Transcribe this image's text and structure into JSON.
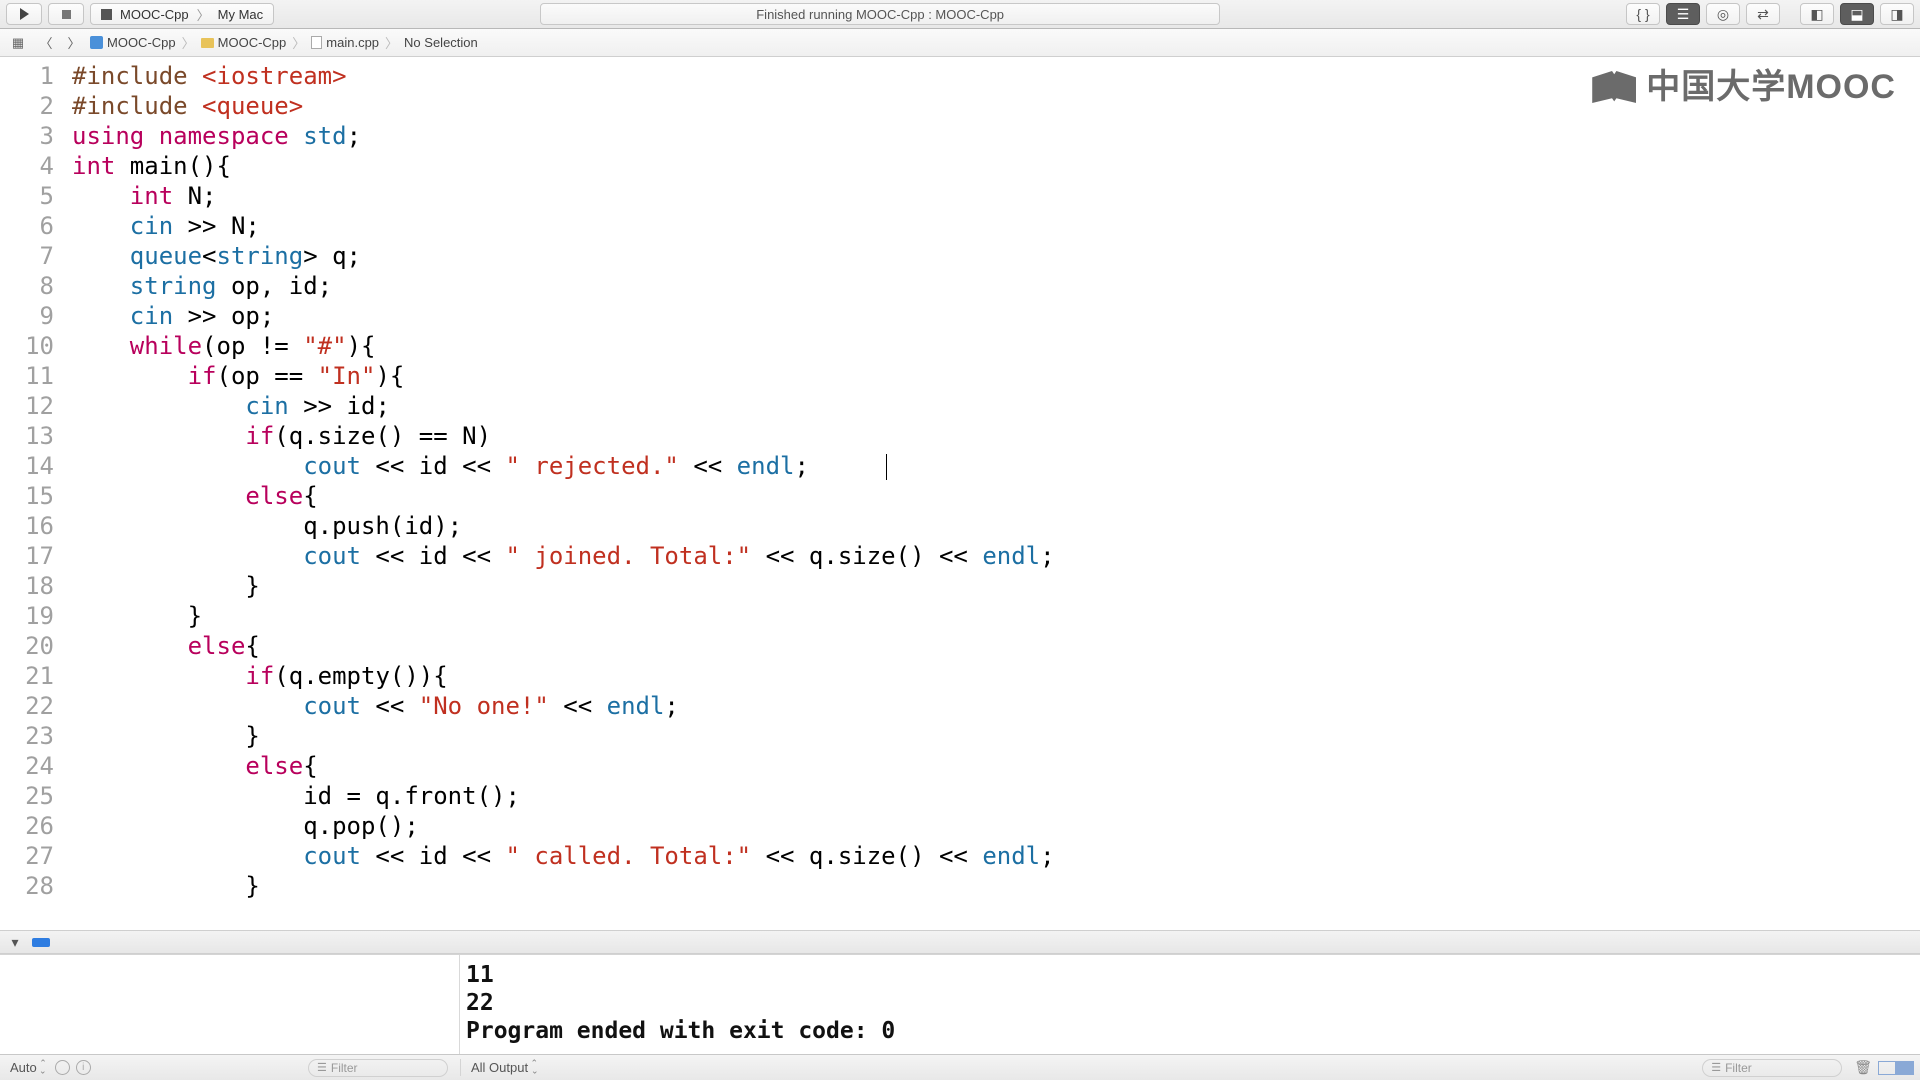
{
  "toolbar": {
    "scheme_project": "MOOC-Cpp",
    "scheme_destination": "My Mac",
    "status": "Finished running MOOC-Cpp : MOOC-Cpp"
  },
  "jumpbar": {
    "project": "MOOC-Cpp",
    "folder": "MOOC-Cpp",
    "file": "main.cpp",
    "selection": "No Selection"
  },
  "watermark": "中国大学MOOC",
  "code": {
    "lines": [
      {
        "n": 1,
        "html": "<span class='pp'>#include</span> <span class='inc'>&lt;iostream&gt;</span>"
      },
      {
        "n": 2,
        "html": "<span class='pp'>#include</span> <span class='inc'>&lt;queue&gt;</span>"
      },
      {
        "n": 3,
        "html": "<span class='kw'>using</span> <span class='kw'>namespace</span> <span class='id'>std</span>;"
      },
      {
        "n": 4,
        "html": "<span class='kw'>int</span> main(){"
      },
      {
        "n": 5,
        "html": "    <span class='kw'>int</span> N;"
      },
      {
        "n": 6,
        "html": "    <span class='id'>cin</span> &gt;&gt; N;"
      },
      {
        "n": 7,
        "html": "    <span class='id'>queue</span>&lt;<span class='id'>string</span>&gt; q;"
      },
      {
        "n": 8,
        "html": "    <span class='id'>string</span> op, id;"
      },
      {
        "n": 9,
        "html": "    <span class='id'>cin</span> &gt;&gt; op;"
      },
      {
        "n": 10,
        "html": "    <span class='kw'>while</span>(op != <span class='str'>\"#\"</span>){"
      },
      {
        "n": 11,
        "html": "        <span class='kw'>if</span>(op == <span class='str'>\"In\"</span>){"
      },
      {
        "n": 12,
        "html": "            <span class='id'>cin</span> &gt;&gt; id;"
      },
      {
        "n": 13,
        "html": "            <span class='kw'>if</span>(q.size() == N)"
      },
      {
        "n": 14,
        "html": "                <span class='id'>cout</span> &lt;&lt; id &lt;&lt; <span class='str'>\" rejected.\"</span> &lt;&lt; <span class='id'>endl</span>;"
      },
      {
        "n": 15,
        "html": "            <span class='kw'>else</span>{"
      },
      {
        "n": 16,
        "html": "                q.push(id);"
      },
      {
        "n": 17,
        "html": "                <span class='id'>cout</span> &lt;&lt; id &lt;&lt; <span class='str'>\" joined. Total:\"</span> &lt;&lt; q.size() &lt;&lt; <span class='id'>endl</span>;"
      },
      {
        "n": 18,
        "html": "            }"
      },
      {
        "n": 19,
        "html": "        }"
      },
      {
        "n": 20,
        "html": "        <span class='kw'>else</span>{"
      },
      {
        "n": 21,
        "html": "            <span class='kw'>if</span>(q.empty()){"
      },
      {
        "n": 22,
        "html": "                <span class='id'>cout</span> &lt;&lt; <span class='str'>\"No one!\"</span> &lt;&lt; <span class='id'>endl</span>;"
      },
      {
        "n": 23,
        "html": "            }"
      },
      {
        "n": 24,
        "html": "            <span class='kw'>else</span>{"
      },
      {
        "n": 25,
        "html": "                id = q.front();"
      },
      {
        "n": 26,
        "html": "                q.pop();"
      },
      {
        "n": 27,
        "html": "                <span class='id'>cout</span> &lt;&lt; id &lt;&lt; <span class='str'>\" called. Total:\"</span> &lt;&lt; q.size() &lt;&lt; <span class='id'>endl</span>;"
      },
      {
        "n": 28,
        "html": "            }"
      }
    ]
  },
  "console": {
    "out1": "11",
    "out2": "22",
    "out3": "Program ended with exit code: 0"
  },
  "bottombar": {
    "auto": "Auto",
    "filter": "Filter",
    "output_mode": "All Output"
  }
}
